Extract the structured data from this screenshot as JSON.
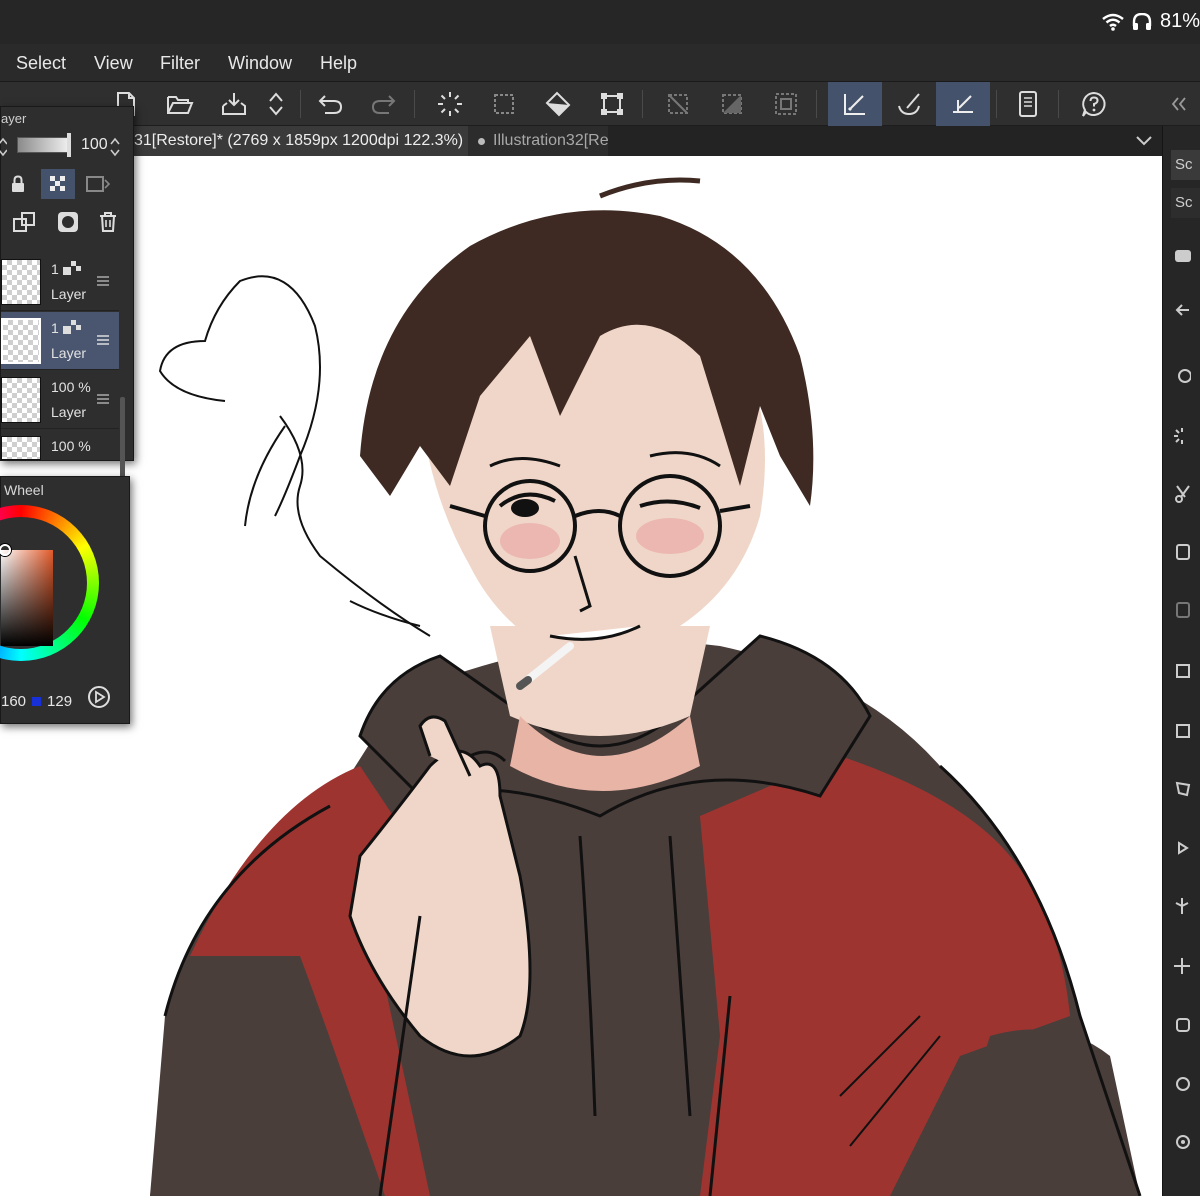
{
  "status_bar": {
    "battery_text": "81%"
  },
  "menu": {
    "items": [
      "Select",
      "View",
      "Filter",
      "Window",
      "Help"
    ]
  },
  "document_tabs": {
    "active": "31[Restore]* (2769 x 1859px 1200dpi 122.3%)",
    "inactive": "Illustration32[Re"
  },
  "layer_panel": {
    "title": "ayer",
    "opacity_value": "100",
    "layers": [
      {
        "opacity": "1",
        "name": "Layer",
        "selected": false
      },
      {
        "opacity": "1",
        "name": "Layer",
        "selected": true
      },
      {
        "opacity": "100 %",
        "name": "Layer",
        "selected": false
      },
      {
        "opacity": "100 %",
        "name": "",
        "selected": false
      }
    ]
  },
  "color_panel": {
    "title": "Wheel",
    "value_left": "160",
    "value_right": "129",
    "accent_blue": "#1830d8"
  },
  "right_strip": {
    "tab_1": "Sc",
    "tab_2": "Sc"
  },
  "colors": {
    "ui_background": "#2b2b2b",
    "active_tool": "#44536b",
    "selected_layer": "#4a5670",
    "hoodie_red": "#9e3430",
    "hoodie_brown": "#4a3e3b",
    "hair": "#3e2a22",
    "skin": "#f0d6c8"
  }
}
